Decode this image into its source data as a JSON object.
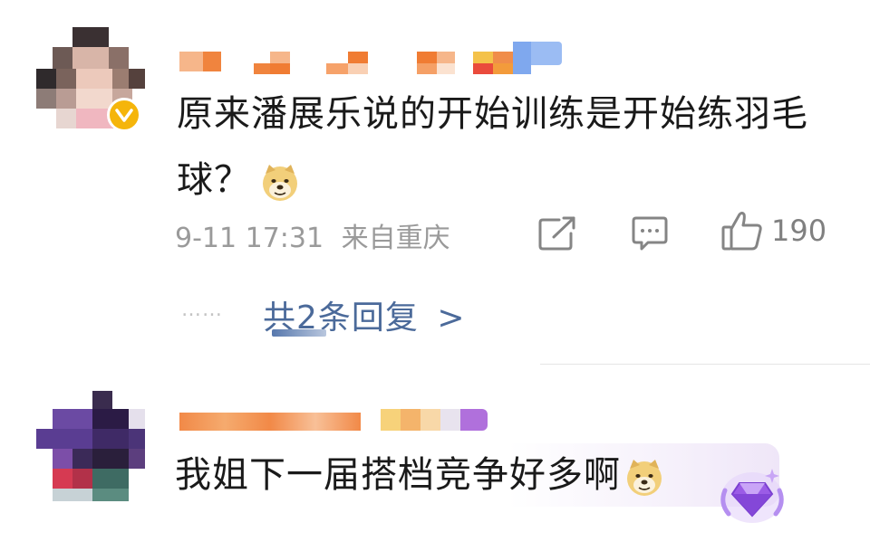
{
  "comment1": {
    "text_line1": "原来潘展乐说的开始训练是开始练羽毛",
    "text_line2": "球？",
    "emoji_icon": "doge-emoji",
    "date": "9-11 17:31",
    "location": "来自重庆",
    "like_count": "190",
    "replies_prefix": "共",
    "replies_count": "2",
    "replies_suffix": "条回复",
    "replies_arrow": ">",
    "replies_dots": "……"
  },
  "comment2": {
    "text": "我姐下一届搭档竞争好多啊",
    "emoji_icon": "doge-emoji",
    "badge_icon": "purple-gem-badge-icon"
  },
  "colors": {
    "text": "#1a1a1a",
    "meta": "#9a9a9a",
    "link": "#4b6a9a",
    "verified": "#f5b50b",
    "username_pixels": "#f07c33"
  }
}
